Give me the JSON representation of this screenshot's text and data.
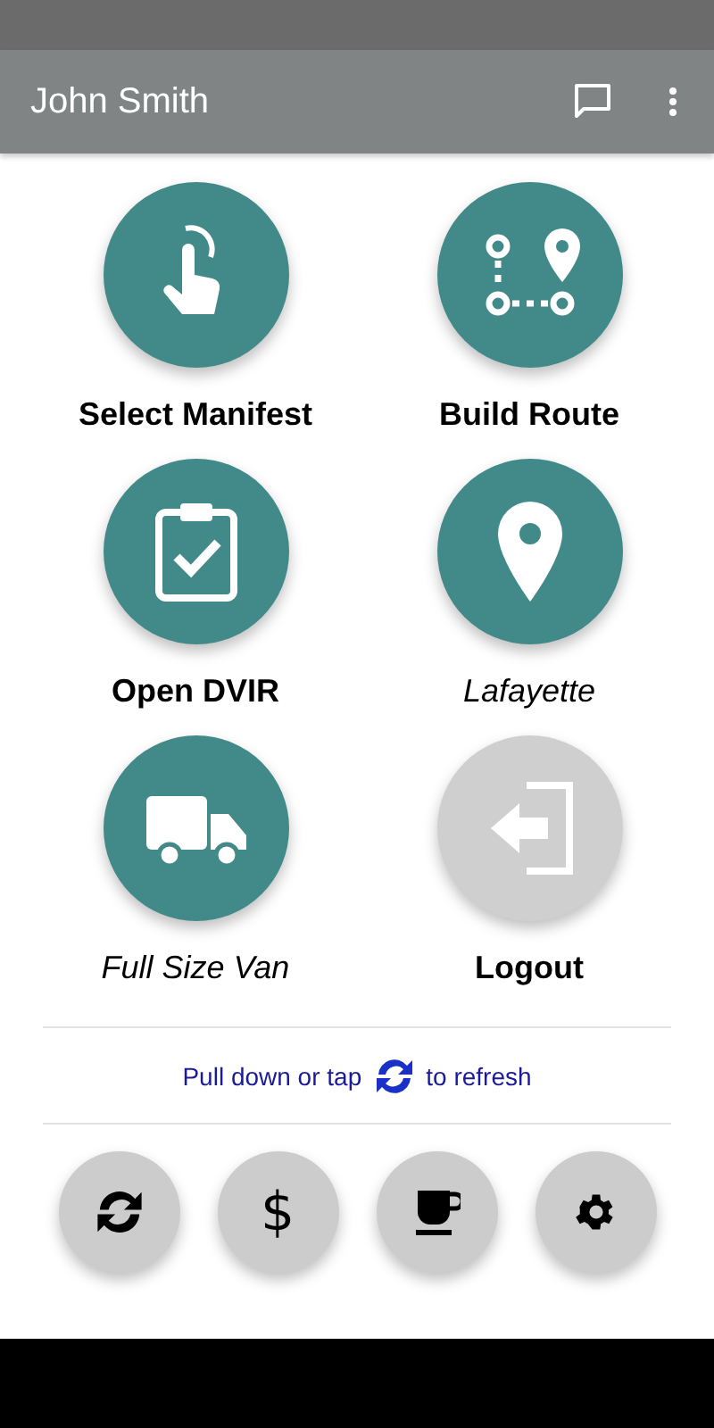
{
  "app_bar": {
    "title": "John Smith"
  },
  "tiles": [
    {
      "kind": "touch",
      "label": "Select Manifest",
      "italic": false,
      "active": true
    },
    {
      "kind": "route",
      "label": "Build Route",
      "italic": false,
      "active": true
    },
    {
      "kind": "clipboard",
      "label": "Open DVIR",
      "italic": false,
      "active": true
    },
    {
      "kind": "pin",
      "label": "Lafayette",
      "italic": true,
      "active": true
    },
    {
      "kind": "truck",
      "label": "Full Size Van",
      "italic": true,
      "active": true
    },
    {
      "kind": "logout",
      "label": "Logout",
      "italic": false,
      "active": false
    }
  ],
  "refresh_hint": {
    "before": "Pull down or tap",
    "after": "to refresh"
  },
  "bottom_buttons": [
    {
      "kind": "refresh"
    },
    {
      "kind": "text",
      "text": "$"
    },
    {
      "kind": "cup"
    },
    {
      "kind": "gear"
    }
  ]
}
